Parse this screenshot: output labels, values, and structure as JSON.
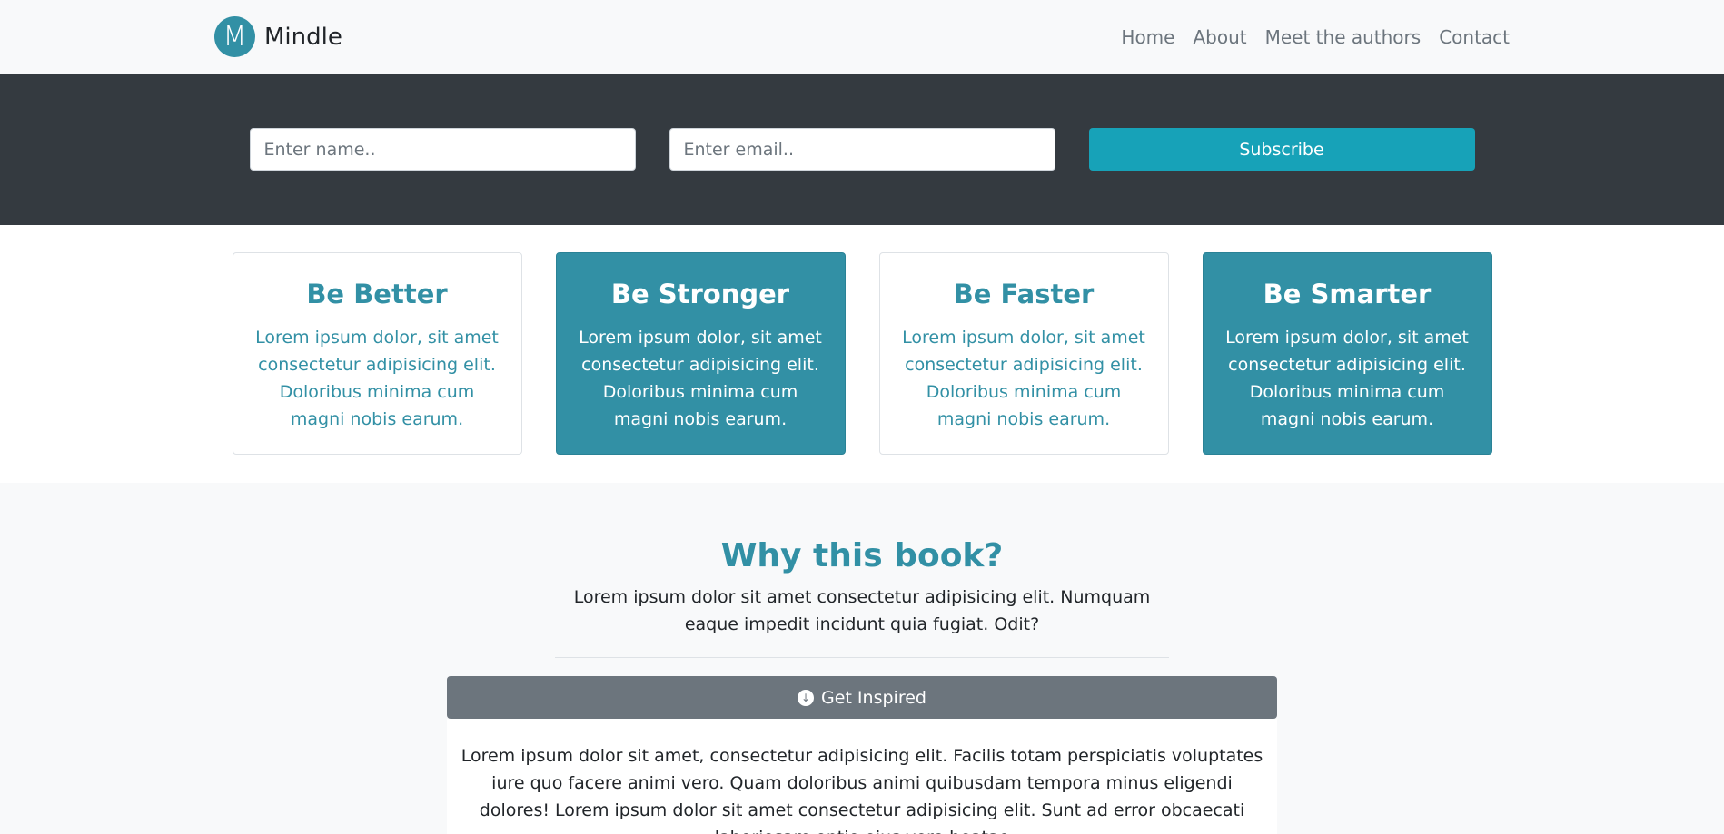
{
  "navbar": {
    "logo_letter": "M",
    "brand": "Mindle",
    "links": [
      "Home",
      "About",
      "Meet the authors",
      "Contact"
    ]
  },
  "subscribe": {
    "name_placeholder": "Enter name..",
    "email_placeholder": "Enter email..",
    "button_label": "Subscribe"
  },
  "cards": [
    {
      "title": "Be Better",
      "text": "Lorem ipsum dolor, sit amet consectetur adipisicing elit. Doloribus minima cum magni nobis earum."
    },
    {
      "title": "Be Stronger",
      "text": "Lorem ipsum dolor, sit amet consectetur adipisicing elit. Doloribus minima cum magni nobis earum."
    },
    {
      "title": "Be Faster",
      "text": "Lorem ipsum dolor, sit amet consectetur adipisicing elit. Doloribus minima cum magni nobis earum."
    },
    {
      "title": "Be Smarter",
      "text": "Lorem ipsum dolor, sit amet consectetur adipisicing elit. Doloribus minima cum magni nobis earum."
    }
  ],
  "why": {
    "title": "Why this book?",
    "text": "Lorem ipsum dolor sit amet consectetur adipisicing elit. Numquam eaque impedit incidunt quia fugiat. Odit?",
    "button_label": "Get Inspired",
    "button_icon": "arrow-circle-down-icon",
    "body": "Lorem ipsum dolor sit amet, consectetur adipisicing elit. Facilis totam perspiciatis voluptates iure quo facere animi vero. Quam doloribus animi quibusdam tempora minus eligendi dolores! Lorem ipsum dolor sit amet consectetur adipisicing elit. Sunt ad error obcaecati laboriosam optio eius vero beatae"
  },
  "colors": {
    "accent": "#3290a5",
    "navbar_bg": "#f8f9fa",
    "dark_band": "#343a40",
    "subscribe_button": "#17a2b8",
    "secondary_button": "#6c757d"
  }
}
